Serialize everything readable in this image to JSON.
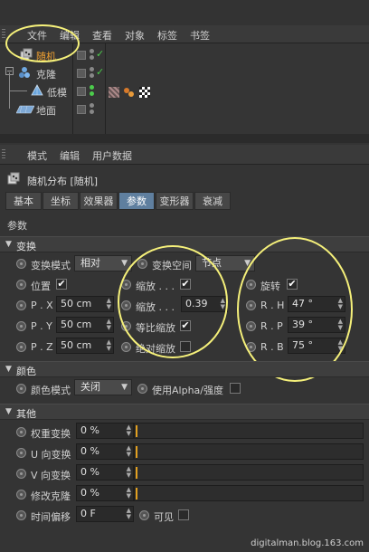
{
  "object_manager": {
    "menu": [
      "文件",
      "编辑",
      "查看",
      "对象",
      "标签",
      "书签"
    ],
    "objects": [
      {
        "name": "随机",
        "icon": "random-effector-icon",
        "active": true
      },
      {
        "name": "克隆",
        "icon": "cloner-icon",
        "active": false
      },
      {
        "name": "低模",
        "icon": "low-poly-icon",
        "active": false
      },
      {
        "name": "地面",
        "icon": "floor-icon",
        "active": false
      }
    ]
  },
  "attribute_manager": {
    "menu": [
      "模式",
      "编辑",
      "用户数据"
    ],
    "title": "随机分布 [随机]",
    "tabs": [
      "基本",
      "坐标",
      "效果器",
      "参数",
      "变形器",
      "衰减"
    ],
    "active_tab": "参数",
    "section_title": "参数",
    "groups": {
      "transform": {
        "title": "变换",
        "mode_label": "变换模式",
        "mode_value": "相对",
        "space_label": "变换空间",
        "space_value": "节点",
        "position_label": "位置",
        "scale_label": "缩放 . . .",
        "rotation_label": "旋转",
        "scale_value_label": "缩放 . . .",
        "scale_value": "0.39",
        "uniform_scale_label": "等比缩放",
        "absolute_scale_label": "绝对缩放",
        "px_label": "P . X",
        "px_value": "50 cm",
        "py_label": "P . Y",
        "py_value": "50 cm",
        "pz_label": "P . Z",
        "pz_value": "50 cm",
        "rh_label": "R . H",
        "rh_value": "47 °",
        "rp_label": "R . P",
        "rp_value": "39 °",
        "rb_label": "R . B",
        "rb_value": "75 °"
      },
      "color": {
        "title": "颜色",
        "mode_label": "颜色模式",
        "mode_value": "关闭",
        "alpha_label": "使用Alpha/强度"
      },
      "other": {
        "title": "其他",
        "weight_label": "权重变换",
        "weight_value": "0 %",
        "u_label": "U 向变换",
        "u_value": "0 %",
        "v_label": "V 向变换",
        "v_value": "0 %",
        "clone_label": "修改克隆",
        "clone_value": "0 %",
        "time_label": "时间偏移",
        "time_value": "0 F",
        "visible_label": "可见"
      }
    }
  },
  "watermark": "digitalman.blog.163.com",
  "colors": {
    "accent": "#5f7f9f",
    "active_object": "#f0a030",
    "annotation": "#f5f07a"
  }
}
